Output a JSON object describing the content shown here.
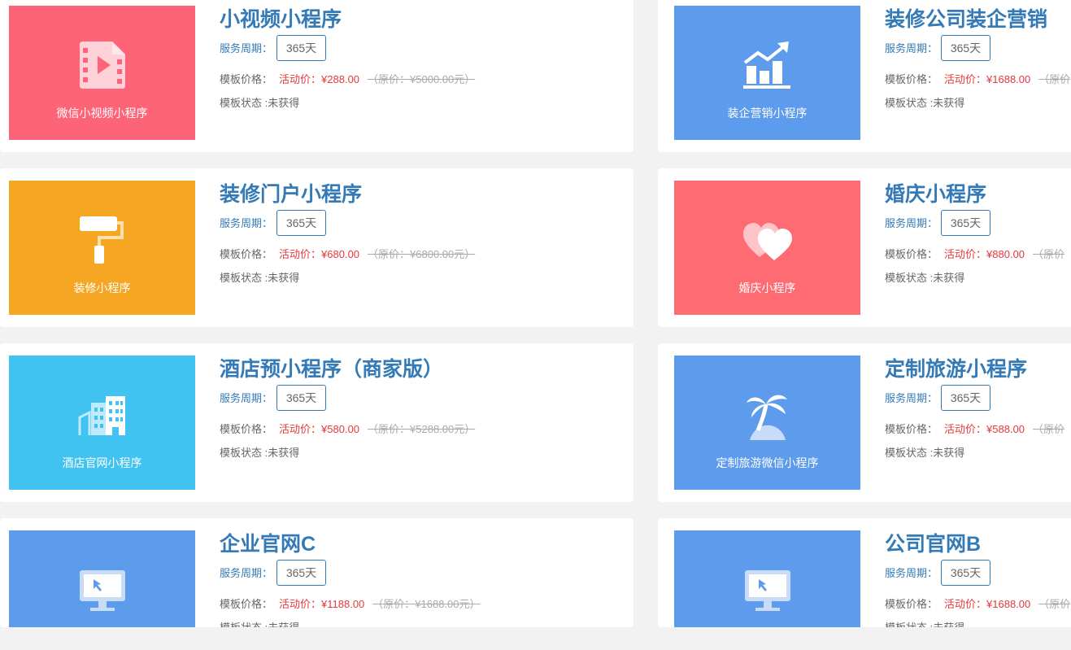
{
  "labels": {
    "period": "服务周期：",
    "price": "模板价格：",
    "activity": "活动价：",
    "status": "模板状态 :未获得"
  },
  "cards": [
    {
      "title": "小视频小程序",
      "thumb_label": "微信小视频小程序",
      "period": "365天",
      "price": "¥288.00",
      "orig": "（原价：¥5000.00元）",
      "thumb_color": "#fe6478",
      "icon": "video-file-icon"
    },
    {
      "title": "装修公司装企营销",
      "thumb_label": "装企营销小程序",
      "period": "365天",
      "price": "¥1688.00",
      "orig": "（原价",
      "thumb_color": "#5d9cec",
      "icon": "growth-chart-icon"
    },
    {
      "title": "装修门户小程序",
      "thumb_label": "装修小程序",
      "period": "365天",
      "price": "¥680.00",
      "orig": "（原价：¥6800.00元）",
      "thumb_color": "#f5a623",
      "icon": "paint-roller-icon"
    },
    {
      "title": "婚庆小程序",
      "thumb_label": "婚庆小程序",
      "period": "365天",
      "price": "¥880.00",
      "orig": "（原价",
      "thumb_color": "#ff6b72",
      "icon": "hearts-icon"
    },
    {
      "title": "酒店预小程序（商家版）",
      "thumb_label": "酒店官网小程序",
      "period": "365天",
      "price": "¥580.00",
      "orig": "（原价：¥5288.00元）",
      "thumb_color": "#40c3f0",
      "icon": "buildings-icon"
    },
    {
      "title": "定制旅游小程序",
      "thumb_label": "定制旅游微信小程序",
      "period": "365天",
      "price": "¥588.00",
      "orig": "（原价",
      "thumb_color": "#5d9cec",
      "icon": "palm-tree-icon"
    },
    {
      "title": "企业官网C",
      "thumb_label": "",
      "period": "365天",
      "price": "¥1188.00",
      "orig": "（原价：¥1688.00元）",
      "thumb_color": "#5d9cec",
      "icon": "monitor-icon"
    },
    {
      "title": "公司官网B",
      "thumb_label": "",
      "period": "365天",
      "price": "¥1688.00",
      "orig": "（原价",
      "thumb_color": "#5d9cec",
      "icon": "monitor-icon"
    }
  ]
}
